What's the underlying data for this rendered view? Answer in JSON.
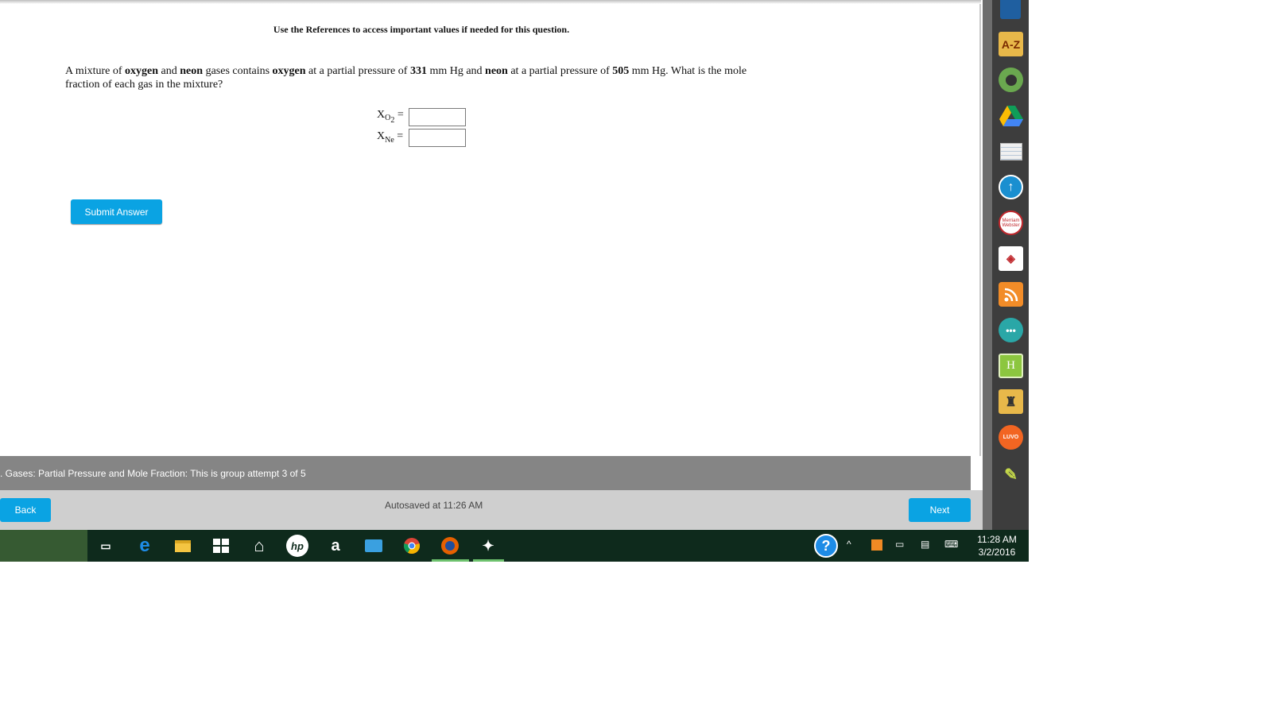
{
  "header": {
    "references_note": "Use the References to access important values if needed for this question."
  },
  "question": {
    "part1": "A mixture of ",
    "gas1": "oxygen",
    "part2": " and ",
    "gas2": "neon",
    "part3": " gases contains ",
    "gas1b": "oxygen",
    "part4": " at a partial pressure of ",
    "p1": "331",
    "part5": " mm Hg and ",
    "gas2b": "neon",
    "part6": " at a partial pressure of ",
    "p2": "505",
    "part7": " mm Hg. What is the mole fraction of each gas in the mixture?"
  },
  "answers": {
    "o2_label_main": "X",
    "o2_label_sub": "O",
    "o2_label_sub2": "2",
    "ne_label_main": "X",
    "ne_label_sub": "Ne",
    "equals": "=",
    "o2_value": "",
    "ne_value": ""
  },
  "submit_label": "Submit Answer",
  "group_bar_text": ". Gases: Partial Pressure and Mole Fraction: This is group attempt 3 of 5",
  "nav": {
    "back_label": "Back",
    "next_label": "Next",
    "autosave_text": "Autosaved at 11:26 AM"
  },
  "extensions": [
    {
      "name": "A-Z",
      "icon": "az-icon",
      "color": "#e8b84a"
    },
    {
      "name": "",
      "icon": "avatar-icon",
      "color": "#6aa84f"
    },
    {
      "name": "",
      "icon": "drive-icon",
      "color": "#fbbc04"
    },
    {
      "name": "",
      "icon": "notepad-icon",
      "color": "#eeeeee"
    },
    {
      "name": "",
      "icon": "upload-icon",
      "color": "#1a8fd0"
    },
    {
      "name": "Merriam Webster",
      "icon": "dictionary-icon",
      "color": "#ffffff"
    },
    {
      "name": "",
      "icon": "cy-icon",
      "color": "#ffffff"
    },
    {
      "name": "",
      "icon": "rss-icon",
      "color": "#f28c28"
    },
    {
      "name": "",
      "icon": "chat-icon",
      "color": "#2aa7a7"
    },
    {
      "name": "H",
      "icon": "hydrogen-icon",
      "color": "#8cc63f"
    },
    {
      "name": "",
      "icon": "classroom-icon",
      "color": "#e8b84a"
    },
    {
      "name": "LUVO",
      "icon": "luvo-icon",
      "color": "#f26522"
    },
    {
      "name": "",
      "icon": "highlighter-icon",
      "color": "#c5d94a"
    }
  ],
  "taskbar": {
    "time": "11:28 AM",
    "date": "3/2/2016",
    "amazon_glyph": "a",
    "hp_glyph": "hp",
    "edge_glyph": "e",
    "help_glyph": "?"
  }
}
